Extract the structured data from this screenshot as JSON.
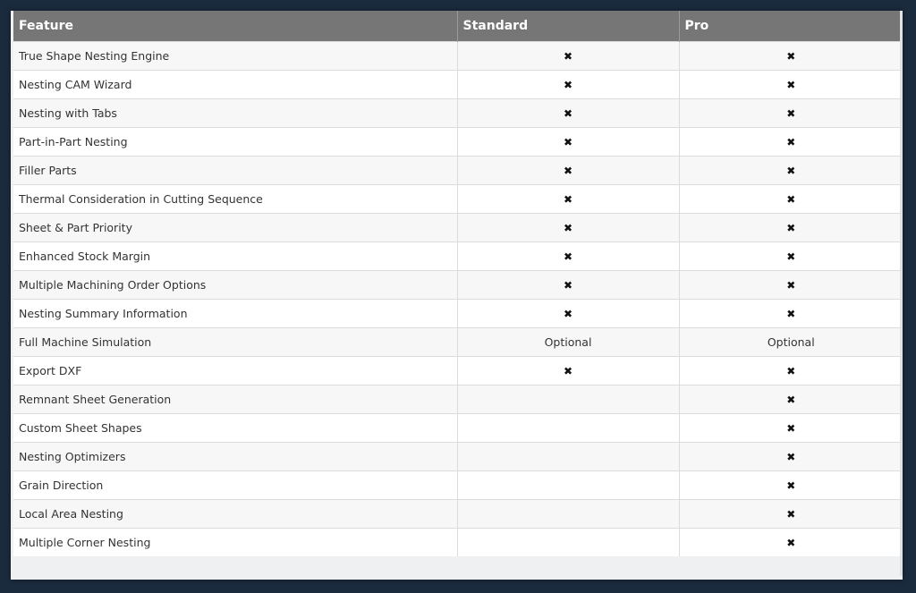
{
  "table": {
    "headers": [
      "Feature",
      "Standard",
      "Pro"
    ],
    "rows": [
      {
        "feature": "True Shape Nesting Engine",
        "standard": "check",
        "pro": "check"
      },
      {
        "feature": "Nesting CAM Wizard",
        "standard": "check",
        "pro": "check"
      },
      {
        "feature": "Nesting with Tabs",
        "standard": "check",
        "pro": "check"
      },
      {
        "feature": "Part-in-Part Nesting",
        "standard": "check",
        "pro": "check"
      },
      {
        "feature": "Filler Parts",
        "standard": "check",
        "pro": "check"
      },
      {
        "feature": "Thermal Consideration in Cutting Sequence",
        "standard": "check",
        "pro": "check"
      },
      {
        "feature": "Sheet & Part Priority",
        "standard": "check",
        "pro": "check"
      },
      {
        "feature": "Enhanced Stock Margin",
        "standard": "check",
        "pro": "check"
      },
      {
        "feature": "Multiple Machining Order Options",
        "standard": "check",
        "pro": "check"
      },
      {
        "feature": "Nesting Summary Information",
        "standard": "check",
        "pro": "check"
      },
      {
        "feature": "Full Machine Simulation",
        "standard": "Optional",
        "pro": "Optional"
      },
      {
        "feature": "Export DXF",
        "standard": "check",
        "pro": "check"
      },
      {
        "feature": "Remnant Sheet Generation",
        "standard": "",
        "pro": "check"
      },
      {
        "feature": "Custom Sheet Shapes",
        "standard": "",
        "pro": "check"
      },
      {
        "feature": "Nesting Optimizers",
        "standard": "",
        "pro": "check"
      },
      {
        "feature": "Grain Direction",
        "standard": "",
        "pro": "check"
      },
      {
        "feature": "Local Area Nesting",
        "standard": "",
        "pro": "check"
      },
      {
        "feature": "Multiple Corner Nesting",
        "standard": "",
        "pro": "check"
      }
    ]
  },
  "icons": {
    "mark_glyph": "✖",
    "mark_icon_name": "x-mark-icon"
  }
}
